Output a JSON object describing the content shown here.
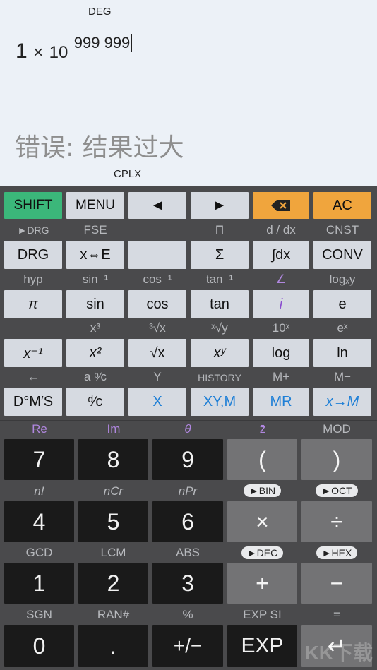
{
  "display": {
    "angle_mode": "DEG",
    "expression": {
      "mantissa": "1",
      "times": "×",
      "base": "10",
      "exponent": "999 999"
    },
    "error": "错误: 结果过大",
    "complex_mode": "CPLX"
  },
  "keys": {
    "shift": "SHIFT",
    "menu": "MENU",
    "left": "◄",
    "right": "►",
    "backspace": "⌫",
    "ac": "AC",
    "drg": "DRG",
    "x_swap_e": "x⇔E",
    "blank": "",
    "sigma": "Σ",
    "integral": "∫dx",
    "conv": "CONV",
    "pi": "π",
    "sin": "sin",
    "cos": "cos",
    "tan": "tan",
    "i": "i",
    "e": "e",
    "x_inv": "x⁻¹",
    "x_sq": "x²",
    "sqrt": "√x",
    "x_pow_y": "xʸ",
    "log": "log",
    "ln": "ln",
    "dms": "D°M′S",
    "frac": "ᵈ⁄c",
    "x": "X",
    "xym": "XY,M",
    "mr": "MR",
    "x_to_m": "x→M",
    "d7": "7",
    "d8": "8",
    "d9": "9",
    "lparen": "(",
    "rparen": ")",
    "d4": "4",
    "d5": "5",
    "d6": "6",
    "mul": "×",
    "div": "÷",
    "d1": "1",
    "d2": "2",
    "d3": "3",
    "plus": "+",
    "minus": "−",
    "d0": "0",
    "dot": ".",
    "negate": "+/−",
    "exp": "EXP",
    "enter": "↵"
  },
  "labels": {
    "row1": [
      "►DRG",
      "FSE",
      "",
      "Π",
      "d / dx",
      "CNST"
    ],
    "row2": [
      "hyp",
      "sin⁻¹",
      "cos⁻¹",
      "tan⁻¹",
      "∠",
      "logₓy"
    ],
    "row3": [
      "",
      "x³",
      "³√x",
      "ˣ√y",
      "10ˣ",
      "eˣ"
    ],
    "row4": [
      "←",
      "a ᵇ⁄c",
      "Y",
      "HISTORY",
      "M+",
      "M−"
    ],
    "row5": [
      "Re",
      "Im",
      "θ",
      "z̄",
      "MOD"
    ],
    "row6": [
      "n!",
      "nCr",
      "nPr",
      "►BIN",
      "►OCT"
    ],
    "row7": [
      "GCD",
      "LCM",
      "ABS",
      "►DEC",
      "►HEX"
    ],
    "row8": [
      "SGN",
      "RAN#",
      "%",
      "EXP SI",
      "="
    ]
  },
  "watermark": "KK下载",
  "colors": {
    "green": "#3bb77a",
    "orange": "#f0a53d",
    "blue": "#1e7fd6",
    "purple": "#8b4fcf"
  }
}
